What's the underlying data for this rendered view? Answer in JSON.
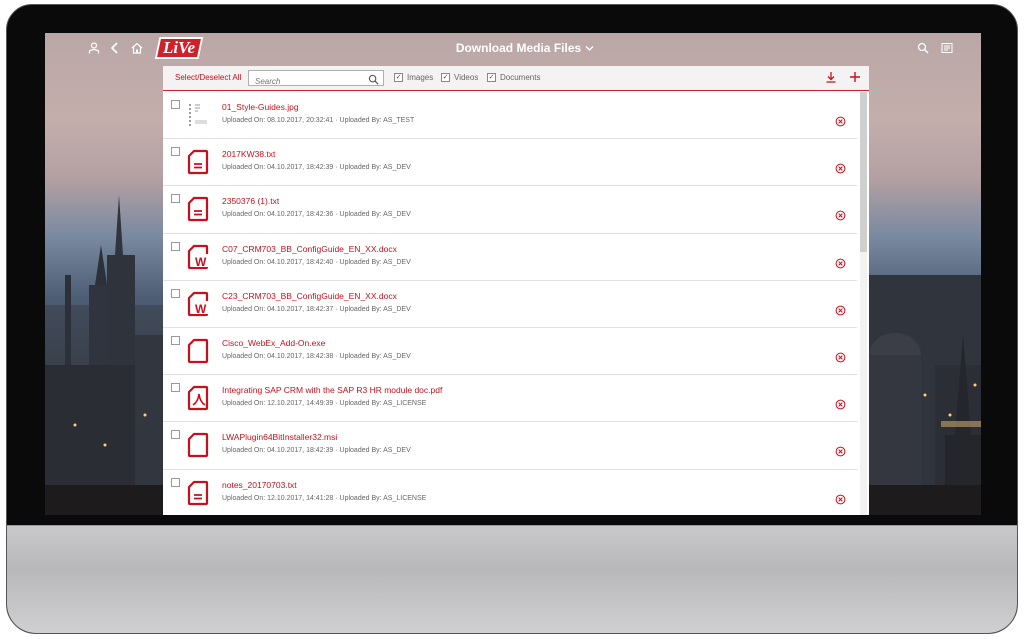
{
  "header": {
    "title": "Download Media Files",
    "logo_text": "LiVe",
    "icons": [
      "user-icon",
      "back-icon",
      "home-icon",
      "search-icon",
      "list-icon"
    ]
  },
  "toolbar": {
    "select_all_label": "Select/Deselect All",
    "search_placeholder": "Search",
    "filters": [
      {
        "label": "Images",
        "checked": true
      },
      {
        "label": "Videos",
        "checked": true
      },
      {
        "label": "Documents",
        "checked": true
      }
    ],
    "download_icon": "download-icon",
    "add_icon": "plus-icon"
  },
  "files": [
    {
      "name": "01_Style-Guides.jpg",
      "meta": "Uploaded On: 08.10.2017, 20:32:41 · Uploaded By: AS_TEST",
      "type": "image"
    },
    {
      "name": "2017KW38.txt",
      "meta": "Uploaded On: 04.10.2017, 18:42:39 · Uploaded By: AS_DEV",
      "type": "text"
    },
    {
      "name": "2350376 (1).txt",
      "meta": "Uploaded On: 04.10.2017, 18:42:36 · Uploaded By: AS_DEV",
      "type": "text"
    },
    {
      "name": "C07_CRM703_BB_ConfigGuide_EN_XX.docx",
      "meta": "Uploaded On: 04.10.2017, 18:42:40 · Uploaded By: AS_DEV",
      "type": "word"
    },
    {
      "name": "C23_CRM703_BB_ConfigGuide_EN_XX.docx",
      "meta": "Uploaded On: 04.10.2017, 18:42:37 · Uploaded By: AS_DEV",
      "type": "word"
    },
    {
      "name": "Cisco_WebEx_Add-On.exe",
      "meta": "Uploaded On: 04.10.2017, 18:42:38 · Uploaded By: AS_DEV",
      "type": "generic"
    },
    {
      "name": "Integrating SAP CRM with the SAP R3 HR module doc.pdf",
      "meta": "Uploaded On: 12.10.2017, 14:49:39 · Uploaded By: AS_LICENSE",
      "type": "pdf"
    },
    {
      "name": "LWAPlugin64BitInstaller32.msi",
      "meta": "Uploaded On: 04.10.2017, 18:42:39 · Uploaded By: AS_DEV",
      "type": "generic"
    },
    {
      "name": "notes_20170703.txt",
      "meta": "Uploaded On: 12.10.2017, 14:41:28 · Uploaded By: AS_LICENSE",
      "type": "text"
    }
  ],
  "colors": {
    "accent": "#c8101c",
    "toolbar_bg": "#f4f2f2"
  }
}
